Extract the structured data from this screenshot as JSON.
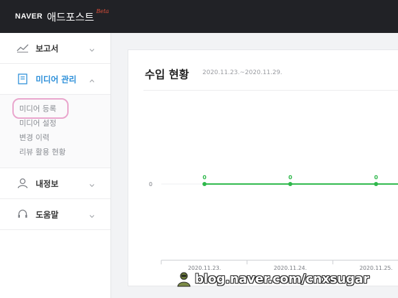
{
  "header": {
    "logo_naver": "NAVER",
    "app_name": "애드포스트",
    "beta": "Beta"
  },
  "sidebar": {
    "items": [
      {
        "label": "보고서",
        "icon": "chart-line-icon",
        "expanded": false
      },
      {
        "label": "미디어 관리",
        "icon": "document-icon",
        "expanded": true,
        "children": [
          "미디어 등록",
          "미디어 설정",
          "변경 이력",
          "리뷰 활용 현황"
        ]
      },
      {
        "label": "내정보",
        "icon": "user-icon",
        "expanded": false
      },
      {
        "label": "도움말",
        "icon": "headset-icon",
        "expanded": false
      }
    ]
  },
  "main": {
    "title": "수입 현황",
    "date_range": "2020.11.23.~2020.11.29."
  },
  "chart_data": {
    "type": "line",
    "categories": [
      "2020.11.23.",
      "2020.11.24.",
      "2020.11.25."
    ],
    "series": [
      {
        "values": [
          0,
          0,
          0
        ],
        "color": "#2eb84b"
      }
    ],
    "data_labels": [
      "0",
      "0",
      "0"
    ],
    "y_tick_labels": [
      "0"
    ],
    "title": "",
    "xlabel": "",
    "ylabel": ""
  },
  "watermark": {
    "text": "blog.naver.com/cnxsugar"
  },
  "colors": {
    "topbar": "#212226",
    "accent": "#2c8fd9",
    "line": "#2eb84b",
    "highlight": "#e9a4cc"
  }
}
